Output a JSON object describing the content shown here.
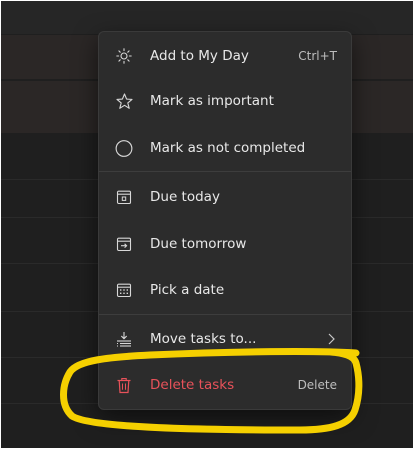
{
  "menu": {
    "items": [
      {
        "label": "Add to My Day",
        "shortcut": "Ctrl+T",
        "icon": "sun-icon"
      },
      {
        "label": "Mark as important",
        "icon": "star-icon"
      },
      {
        "label": "Mark as not completed",
        "icon": "circle-icon"
      },
      {
        "label": "Due today",
        "icon": "calendar-today-icon"
      },
      {
        "label": "Due tomorrow",
        "icon": "calendar-tomorrow-icon"
      },
      {
        "label": "Pick a date",
        "icon": "calendar-pick-icon"
      },
      {
        "label": "Move tasks to...",
        "icon": "move-list-icon",
        "submenu": true
      },
      {
        "label": "Delete tasks",
        "shortcut": "Delete",
        "icon": "trash-icon",
        "danger": true
      }
    ]
  },
  "colors": {
    "background": "#1f1f1f",
    "menu_background": "#2c2c2c",
    "text": "#e8e8e8",
    "danger": "#e8525a",
    "highlight": "#f5d000"
  }
}
